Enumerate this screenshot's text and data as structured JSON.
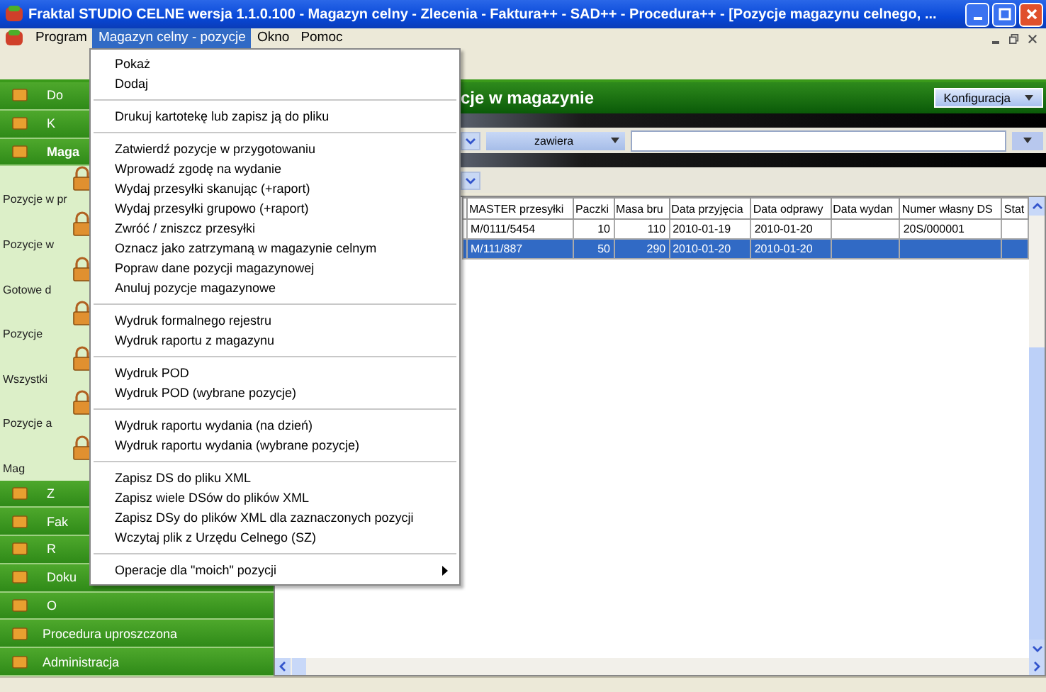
{
  "window": {
    "title": "Fraktal STUDIO CELNE   wersja 1.1.0.100 - Magazyn celny - Zlecenia - Faktura++ - SAD++ - Procedura++ - [Pozycje magazynu celnego, ..."
  },
  "menubar": [
    {
      "label": "Program",
      "selected": false
    },
    {
      "label": "Magazyn celny - pozycje",
      "selected": true
    },
    {
      "label": "Okno",
      "selected": false
    },
    {
      "label": "Pomoc",
      "selected": false
    }
  ],
  "open_menu": {
    "groups": [
      [
        {
          "label": "Pokaż",
          "submenu": false
        },
        {
          "label": "Dodaj",
          "submenu": false
        }
      ],
      [
        {
          "label": "Drukuj kartotekę lub zapisz ją do pliku",
          "submenu": false
        }
      ],
      [
        {
          "label": "Zatwierdź pozycje w przygotowaniu",
          "submenu": false
        },
        {
          "label": "Wprowadź zgodę na wydanie",
          "submenu": false
        },
        {
          "label": "Wydaj przesyłki skanując (+raport)",
          "submenu": false
        },
        {
          "label": "Wydaj przesyłki grupowo (+raport)",
          "submenu": false
        },
        {
          "label": "Zwróć / zniszcz przesyłki",
          "submenu": false
        },
        {
          "label": "Oznacz jako zatrzymaną w magazynie celnym",
          "submenu": false
        },
        {
          "label": "Popraw dane pozycji magazynowej",
          "submenu": false
        },
        {
          "label": "Anuluj pozycje magazynowe",
          "submenu": false
        }
      ],
      [
        {
          "label": "Wydruk formalnego rejestru",
          "submenu": false
        },
        {
          "label": "Wydruk raportu z magazynu",
          "submenu": false
        }
      ],
      [
        {
          "label": "Wydruk POD",
          "submenu": false
        },
        {
          "label": "Wydruk POD (wybrane pozycje)",
          "submenu": false
        }
      ],
      [
        {
          "label": "Wydruk raportu wydania (na dzień)",
          "submenu": false
        },
        {
          "label": "Wydruk raportu wydania (wybrane pozycje)",
          "submenu": false
        }
      ],
      [
        {
          "label": "Zapisz DS do pliku XML",
          "submenu": false
        },
        {
          "label": "Zapisz wiele DSów do plików XML",
          "submenu": false
        },
        {
          "label": "Zapisz DSy do plików XML dla zaznaczonych pozycji",
          "submenu": false
        },
        {
          "label": "Wczytaj plik z Urzędu Celnego (SZ)",
          "submenu": false
        }
      ],
      [
        {
          "label": "Operacje dla \"moich\" pozycji",
          "submenu": true
        }
      ]
    ]
  },
  "sidebar": [
    {
      "kind": "section",
      "label": "Do",
      "selected": false
    },
    {
      "kind": "section",
      "label": "K",
      "selected": false
    },
    {
      "kind": "section",
      "label": "Maga",
      "selected": true
    },
    {
      "kind": "subitem",
      "label": "Pozycje w pr"
    },
    {
      "kind": "subitem",
      "label": "Pozycje w"
    },
    {
      "kind": "subitem",
      "label": "Gotowe d"
    },
    {
      "kind": "subitem",
      "label": "Pozycje"
    },
    {
      "kind": "subitem",
      "label": "Wszystki"
    },
    {
      "kind": "subitem",
      "label": "Pozycje a"
    },
    {
      "kind": "subitem",
      "label": "Mag"
    },
    {
      "kind": "section",
      "label": "Z",
      "selected": false
    },
    {
      "kind": "section",
      "label": "Fak",
      "selected": false
    },
    {
      "kind": "section",
      "label": "R",
      "selected": false
    },
    {
      "kind": "section",
      "label": "Doku",
      "selected": false
    },
    {
      "kind": "section",
      "label": "O",
      "selected": false
    },
    {
      "kind": "section",
      "label": "Procedura uproszczona",
      "selected": false
    },
    {
      "kind": "section",
      "label": "Administracja",
      "selected": false
    }
  ],
  "main": {
    "title": "cje w magazynie",
    "config_button": "Konfiguracja",
    "filter_operator": "zawiera",
    "table": {
      "columns": [
        "MASTER przesyłki",
        "Paczki",
        "Masa bru",
        "Data przyjęcia",
        "Data odprawy",
        "Data wydan",
        "Numer własny DS",
        "Stat"
      ],
      "rows": [
        {
          "cells": [
            "M/0111/5454",
            "10",
            "110",
            "2010-01-19",
            "2010-01-20",
            "",
            "20S/000001",
            ""
          ],
          "selected": false
        },
        {
          "cells": [
            "M/111/887",
            "50",
            "290",
            "2010-01-20",
            "2010-01-20",
            "",
            "",
            ""
          ],
          "selected": true
        }
      ]
    }
  }
}
